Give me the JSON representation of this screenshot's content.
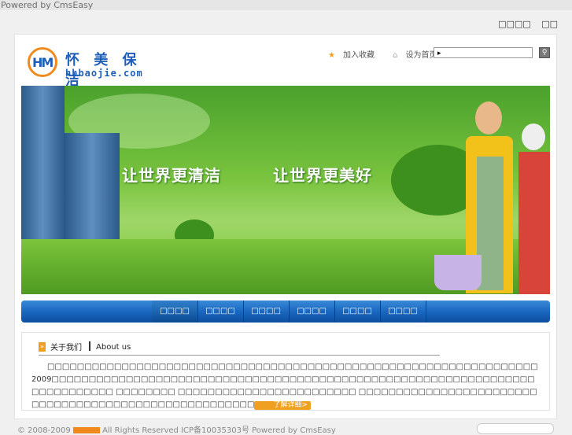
{
  "powered_top": "Powered by CmsEasy",
  "top_links": [
    "□□□□",
    "□□"
  ],
  "logo": {
    "mark": "HM",
    "name_cn": "怀 美 保 洁",
    "name_en": "hhbaojie.com"
  },
  "header_links": {
    "favorite": "加入收藏",
    "homepage": "设为首页"
  },
  "search": {
    "value": "▸"
  },
  "banner": {
    "slogan_left": "让世界更清洁",
    "slogan_right": "让世界更美好"
  },
  "nav": [
    "□□□□",
    "□□□□",
    "□□□□",
    "□□□□",
    "□□□□",
    "□□□□"
  ],
  "about": {
    "title_cn": "关于我们",
    "title_en": "About us",
    "body": "□□□□□□□□□□□□□□□□□□□□□□□□□□□□□□□□□□□□□□□□□□□□□□□□□□□□□□□□□□□□□□□□□□2009□□□□□□□□□□□□□□□□□□□□□□□□□□□□□□□□□□□□□□□□□□□□□□□□□□□□□□□□□□□□□□□□□□□□□□□□□□□□ □□□□□□□□ □□□□□□□□□□□□□□□□□□□□□□□□ □□□□□□□□□□□□□□□□□□□□□□□□□□□□□□□□□□□□□□□□□□□□□□□□□□□□□□",
    "more": "了解详细>"
  },
  "footer": {
    "left": "© 2008-2009",
    "right": "All Rights Reserved   ICP备10035303号   Powered by CmsEasy"
  },
  "colors": {
    "brand_blue": "#1d5fb8",
    "accent_orange": "#f08a1c",
    "nav_blue": "#1a67c0"
  }
}
